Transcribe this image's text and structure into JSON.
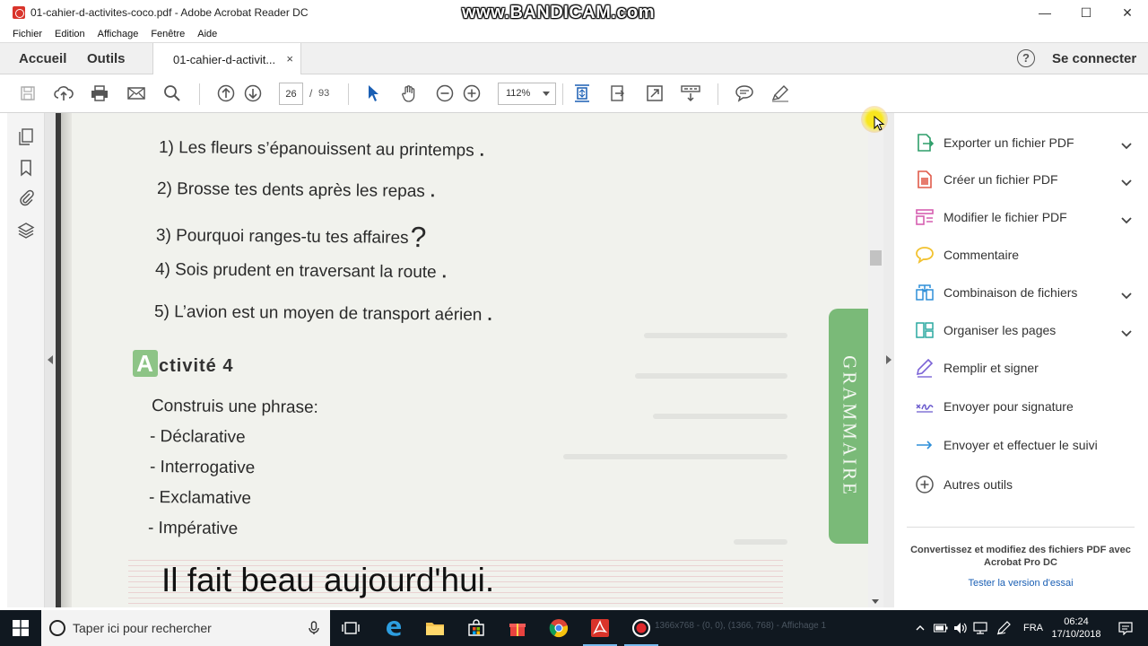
{
  "window": {
    "title": "01-cahier-d-activites-coco.pdf - Adobe Acrobat Reader DC",
    "watermark": "www.BANDICAM.com",
    "minimize": "—",
    "maximize": "☐",
    "close": "✕"
  },
  "menu": [
    "Fichier",
    "Edition",
    "Affichage",
    "Fenêtre",
    "Aide"
  ],
  "tabs": {
    "home": "Accueil",
    "tools": "Outils",
    "document": "01-cahier-d-activit...",
    "document_close": "×",
    "help": "?",
    "signin": "Se connecter"
  },
  "toolbar": {
    "page_current": "26",
    "page_sep": "/",
    "page_total": "93",
    "zoom": "112%"
  },
  "document": {
    "sentences": [
      {
        "text": "1) Les fleurs s’épanouissent au printemps",
        "end": "."
      },
      {
        "text": "2) Brosse tes dents après les repas",
        "end": "."
      },
      {
        "text": "3) Pourquoi ranges-tu tes affaires",
        "end": "?"
      },
      {
        "text": "4) Sois prudent en traversant la route",
        "end": "."
      },
      {
        "text": "5) L’avion est un moyen de transport aérien",
        "end": "."
      }
    ],
    "activity_letter": "A",
    "activity_rest": "ctivité 4",
    "instruction": "Construis une phrase:",
    "types": [
      "- Déclarative",
      "- Interrogative",
      "- Exclamative",
      "- Impérative"
    ],
    "typed_answer": "Il fait beau aujourd'hui.",
    "side_tab": "GRAMMAIRE"
  },
  "tools_pane": {
    "items": [
      {
        "label": "Exporter un fichier PDF",
        "icon": "export-pdf-icon",
        "expand": true,
        "color": "#2e9e6a"
      },
      {
        "label": "Créer un fichier PDF",
        "icon": "create-pdf-icon",
        "expand": true,
        "color": "#e05b4b"
      },
      {
        "label": "Modifier le fichier PDF",
        "icon": "edit-pdf-icon",
        "expand": true,
        "color": "#d65fb0"
      },
      {
        "label": "Commentaire",
        "icon": "comment-icon",
        "expand": false,
        "color": "#f2c230"
      },
      {
        "label": "Combinaison de fichiers",
        "icon": "combine-files-icon",
        "expand": true,
        "color": "#2f8fd8"
      },
      {
        "label": "Organiser les pages",
        "icon": "organize-pages-icon",
        "expand": true,
        "color": "#2aa8a0"
      },
      {
        "label": "Remplir et signer",
        "icon": "fill-sign-icon",
        "expand": false,
        "color": "#7b63d6"
      },
      {
        "label": "Envoyer pour signature",
        "icon": "send-signature-icon",
        "expand": false,
        "color": "#6a5acd"
      },
      {
        "label": "Envoyer et effectuer le suivi",
        "icon": "send-track-icon",
        "expand": false,
        "color": "#2f8fd8"
      },
      {
        "label": "Autres outils",
        "icon": "more-tools-icon",
        "expand": false,
        "color": "#555555"
      }
    ],
    "pro_text": "Convertissez et modifiez des fichiers PDF avec Acrobat Pro DC",
    "pro_link": "Tester la version d'essai"
  },
  "taskbar": {
    "search_placeholder": "Taper ici pour rechercher",
    "ghost_status": "1366x768 - (0, 0), (1366, 768) - Affichage 1",
    "language": "FRA",
    "time": "06:24",
    "date": "17/10/2018"
  }
}
